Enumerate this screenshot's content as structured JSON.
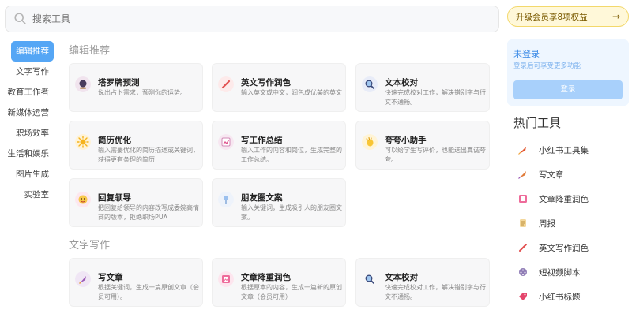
{
  "search": {
    "placeholder": "搜索工具"
  },
  "upgrade": {
    "label": "升级会员享8项权益",
    "arrow": "→"
  },
  "sidebar": {
    "items": [
      {
        "label": "编辑推荐"
      },
      {
        "label": "文字写作"
      },
      {
        "label": "教育工作者"
      },
      {
        "label": "新媒体运营"
      },
      {
        "label": "职场效率"
      },
      {
        "label": "生活和娱乐"
      },
      {
        "label": "图片生成"
      },
      {
        "label": "实验室"
      }
    ]
  },
  "sections": [
    {
      "title": "编辑推荐",
      "cards": [
        {
          "title": "塔罗牌预测",
          "desc": "说出占卜需求，预测你的运势。"
        },
        {
          "title": "英文写作润色",
          "desc": "输入英文或中文，润色成优美的英文"
        },
        {
          "title": "文本校对",
          "desc": "快速完成校对工作，解决错别字与行文不通畅。"
        },
        {
          "title": "简历优化",
          "desc": "输入需要优化的简历描述或关键词，获得更有条理的简历"
        },
        {
          "title": "写工作总结",
          "desc": "输入工作的内容和岗位，生成完整的工作总结。"
        },
        {
          "title": "夸夸小助手",
          "desc": "可以给学生写评价，也能送出真诚夸夸。"
        },
        {
          "title": "回复领导",
          "desc": "把回复给领导的内容改写成委婉高情商的版本，拒绝职场PUA"
        },
        {
          "title": "朋友圈文案",
          "desc": "输入关键词，生成吸引人的朋友圈文案。"
        }
      ]
    },
    {
      "title": "文字写作",
      "cards": [
        {
          "title": "写文章",
          "desc": "根据关键词，生成一篇原创文章（会员可用）。"
        },
        {
          "title": "文章降重润色",
          "desc": "根据原本的内容，生成一篇新的原创文章（会员可用）"
        },
        {
          "title": "文本校对",
          "desc": "快速完成校对工作，解决错别字与行文不通畅。"
        }
      ]
    }
  ],
  "account": {
    "status": "未登录",
    "hint": "登录后可享受更多功能",
    "login_label": "登录"
  },
  "hot": {
    "title": "热门工具",
    "items": [
      {
        "label": "小红书工具集"
      },
      {
        "label": "写文章"
      },
      {
        "label": "文章降重润色"
      },
      {
        "label": "周报"
      },
      {
        "label": "英文写作润色"
      },
      {
        "label": "短视频脚本"
      },
      {
        "label": "小红书标题"
      }
    ]
  }
}
